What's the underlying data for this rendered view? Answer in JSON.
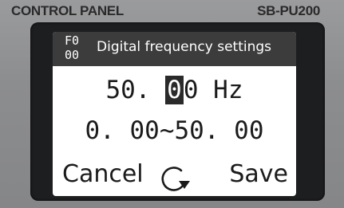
{
  "panel": {
    "title": "CONTROL PANEL",
    "model": "SB-PU200"
  },
  "screen": {
    "code_line1": "F0",
    "code_line2": "00",
    "title": "Digital frequency settings",
    "value_prefix": "50.",
    "value_space": " ",
    "value_cursor_digit": "0",
    "value_last_digit": "0",
    "value_unit": " Hz",
    "range": "0. 00~50. 00"
  },
  "softkeys": {
    "cancel_label": "Cancel",
    "confirm_icon": "rotate-clockwise-icon",
    "save_label": "Save"
  },
  "colors": {
    "header_bar": "#3c3c3d",
    "screen_bg": "#ffffff",
    "bezel": "#1d1e1f",
    "panel": "#8d8e90"
  }
}
